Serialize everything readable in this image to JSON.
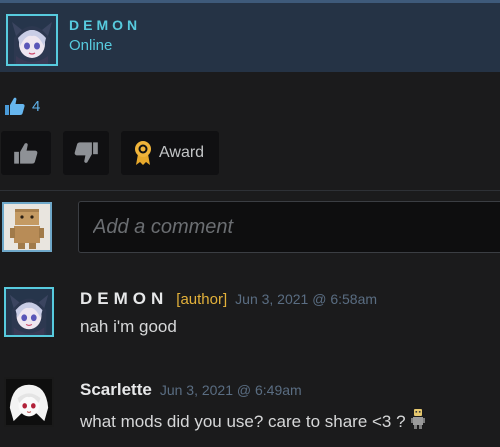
{
  "author": {
    "name": "DEMON",
    "status": "Online",
    "avatar_icon": "anime-girl-avatar-icon"
  },
  "rating": {
    "icon": "thumbs-up-icon",
    "count": "4"
  },
  "votes": {
    "upvote_icon": "thumbs-up-icon",
    "downvote_icon": "thumbs-down-icon",
    "award_icon": "award-ribbon-icon",
    "award_label": "Award"
  },
  "comment_input": {
    "placeholder": "Add a comment",
    "value": "",
    "avatar_icon": "cardboard-box-robot-avatar-icon"
  },
  "comments": [
    {
      "name": "DEMON",
      "author_badge": "[author]",
      "time": "Jun 3, 2021 @ 6:58am",
      "text": "nah i'm good",
      "avatar_icon": "anime-girl-avatar-icon"
    },
    {
      "name": "Scarlette",
      "time": "Jun 3, 2021 @ 6:49am",
      "text": "what mods did you use? care to share <3 ?",
      "avatar_icon": "white-hair-girl-avatar-icon",
      "emote_icon": "little-robot-emote-icon"
    }
  ],
  "colors": {
    "online": "#57cbde",
    "author_badge": "#e3b13a",
    "timestamp": "#5a6d82",
    "header_bg": "#253345",
    "page_bg": "#1b1b1c"
  }
}
